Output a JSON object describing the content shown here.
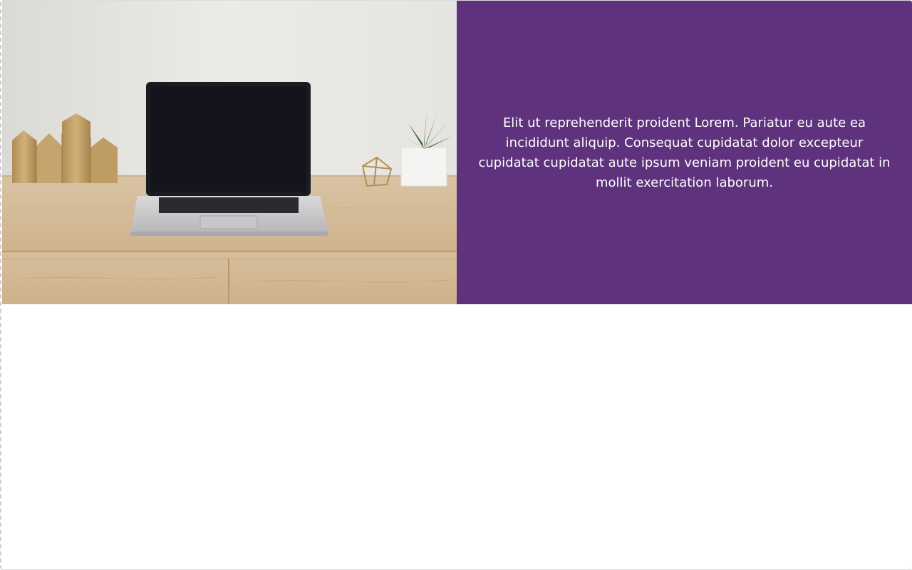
{
  "theme": {
    "accent": "#5e327c",
    "text_on_accent": "#ffffff"
  },
  "hero": {
    "image_icon": "desk-laptop-photo",
    "paragraph": "Elit ut reprehenderit proident Lorem. Pariatur eu aute ea incididunt aliquip. Consequat cupidatat dolor excepteur cupidatat cupidatat aute ipsum veniam proident eu cupidatat in mollit exercitation laborum."
  }
}
